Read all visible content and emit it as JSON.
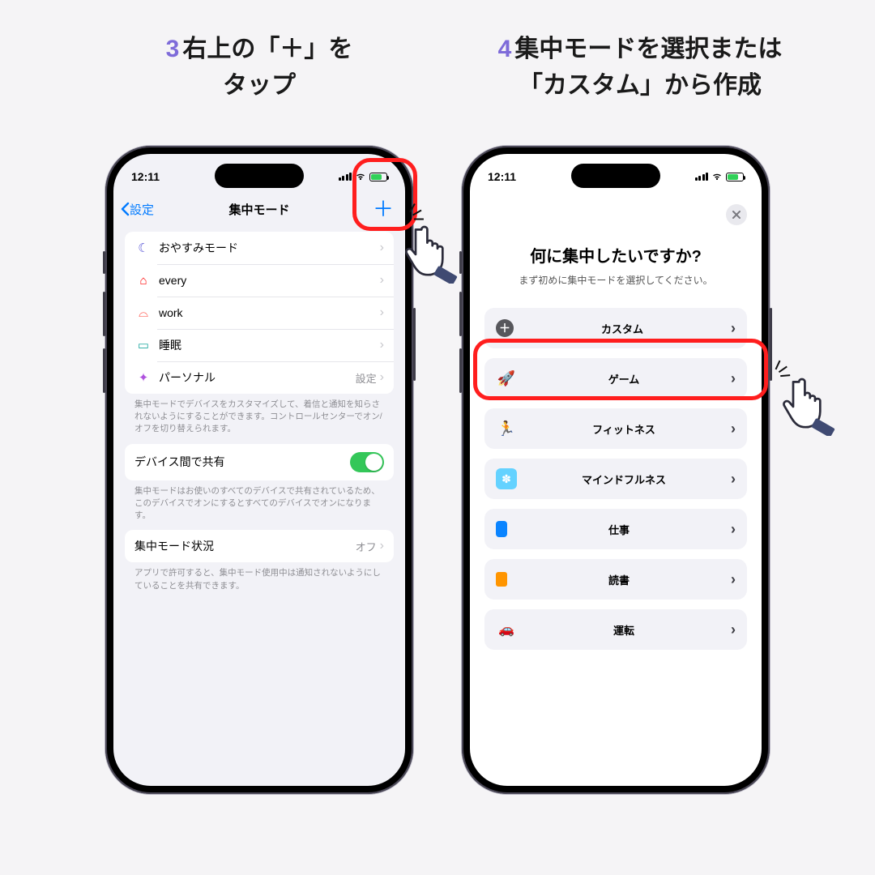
{
  "step3": {
    "num": "3",
    "text_l1": "右上の「＋」を",
    "text_l2": "タップ"
  },
  "step4": {
    "num": "4",
    "text_l1": "集中モードを選択または",
    "text_l2": "「カスタム」から作成"
  },
  "status": {
    "time": "12:11"
  },
  "screen1": {
    "back": "設定",
    "title": "集中モード",
    "plus": "＋",
    "focus_modes": [
      {
        "icon": "🌙",
        "color": "#5856d6",
        "label": "おやすみモード"
      },
      {
        "icon": "⌂",
        "color": "#ff3b30",
        "label": "every"
      },
      {
        "icon": "🎧",
        "color": "#ff3b30",
        "label": "work"
      },
      {
        "icon": "🛏",
        "color": "#30cfcf",
        "label": "睡眠"
      },
      {
        "icon": "👤",
        "color": "#af52de",
        "label": "パーソナル",
        "detail": "設定"
      }
    ],
    "note1": "集中モードでデバイスをカスタマイズして、着信と通知を知らされないようにすることができます。コントロールセンターでオン/オフを切り替えられます。",
    "share_label": "デバイス間で共有",
    "note2": "集中モードはお使いのすべてのデバイスで共有されているため、このデバイスでオンにするとすべてのデバイスでオンになります。",
    "status_label": "集中モード状況",
    "status_value": "オフ",
    "note3": "アプリで許可すると、集中モード使用中は通知されないようにしていることを共有できます。"
  },
  "screen2": {
    "title": "何に集中したいですか?",
    "subtitle": "まず初めに集中モードを選択してください。",
    "options": [
      {
        "key": "custom",
        "label": "カスタム"
      },
      {
        "key": "game",
        "label": "ゲーム"
      },
      {
        "key": "fitness",
        "label": "フィットネス"
      },
      {
        "key": "mindfulness",
        "label": "マインドフルネス"
      },
      {
        "key": "job",
        "label": "仕事"
      },
      {
        "key": "reading",
        "label": "読書"
      },
      {
        "key": "driving",
        "label": "運転"
      }
    ]
  }
}
